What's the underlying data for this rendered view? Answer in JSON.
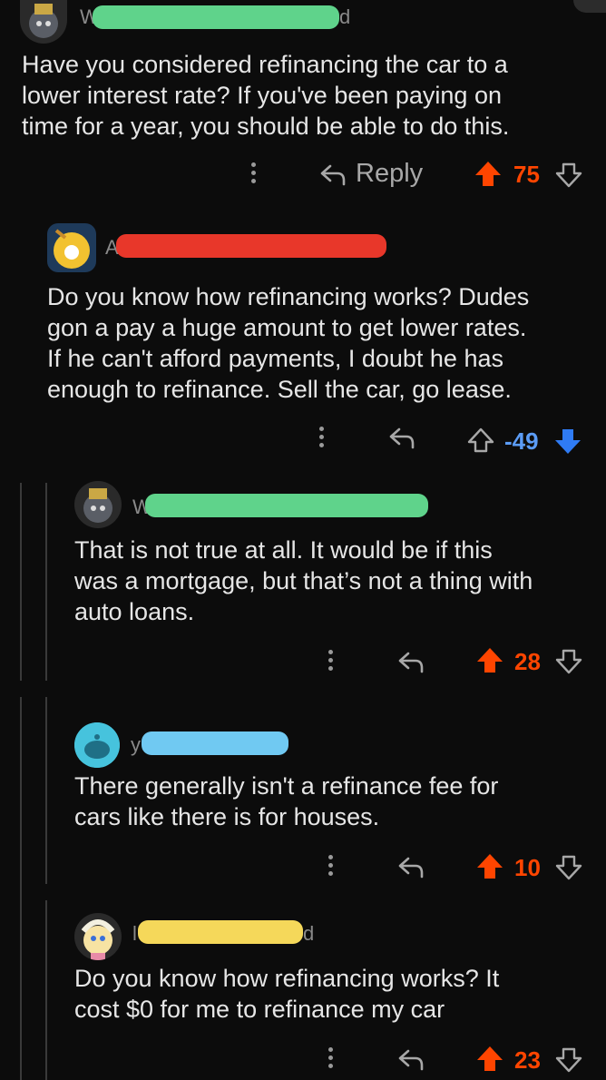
{
  "colors": {
    "upvote": "#ff4500",
    "downvote": "#2f7bf4",
    "bg": "#0c0c0c",
    "redact_green": "#5fd38b",
    "redact_red": "#e8372a",
    "redact_blue": "#70c9f2",
    "redact_yellow": "#f5d85a"
  },
  "comments": [
    {
      "user_prefix": "W",
      "user_suffix": "d",
      "body": [
        "Have you considered refinancing the car to a",
        "lower interest rate? If you've been paying on",
        "time for a year, you should be able to do this."
      ],
      "reply_label": "Reply",
      "score": "75",
      "vote": "up"
    },
    {
      "user_prefix": "A",
      "user_suffix": "",
      "body": [
        "Do you know how refinancing works? Dudes",
        "gon a pay a huge amount to get lower rates.",
        "If he can't afford payments, I doubt he has",
        "enough to refinance. Sell the car, go lease."
      ],
      "score": "-49",
      "vote": "down"
    },
    {
      "user_prefix": "W",
      "user_suffix": "",
      "body": [
        "That is not true at all. It would be if this",
        "was a mortgage, but that’s not a thing with",
        "auto loans."
      ],
      "score": "28",
      "vote": "up"
    },
    {
      "user_prefix": "y",
      "user_suffix": "",
      "body": [
        "There generally isn't a refinance fee for",
        "cars like there is for houses."
      ],
      "score": "10",
      "vote": "up"
    },
    {
      "user_prefix": "l",
      "user_suffix": "d",
      "body": [
        "Do you know how refinancing works? It",
        "cost $0 for me to refinance my car"
      ],
      "score": "23",
      "vote": "up"
    }
  ],
  "icons": {
    "more": "kebab-icon",
    "reply": "reply-arrow-icon",
    "up": "upvote-icon",
    "down": "downvote-icon"
  }
}
